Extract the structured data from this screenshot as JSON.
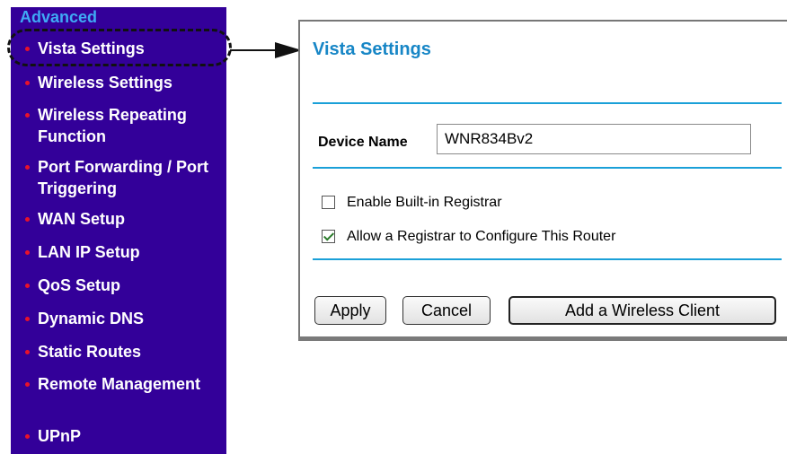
{
  "sidebar": {
    "heading": "Advanced",
    "items": [
      {
        "label": "Vista Settings"
      },
      {
        "label": "Wireless Settings"
      },
      {
        "label": "Wireless Repeating Function"
      },
      {
        "label": "Port Forwarding / Port Triggering"
      },
      {
        "label": "WAN Setup"
      },
      {
        "label": "LAN IP Setup"
      },
      {
        "label": "QoS Setup"
      },
      {
        "label": "Dynamic DNS"
      },
      {
        "label": "Static Routes"
      },
      {
        "label": "Remote Management"
      },
      {
        "label": "UPnP"
      }
    ]
  },
  "panel": {
    "title": "Vista Settings",
    "device_name_label": "Device Name",
    "device_name_value": "WNR834Bv2",
    "options": [
      {
        "label": "Enable Built-in Registrar",
        "checked": false
      },
      {
        "label": "Allow a Registrar to Configure This Router",
        "checked": true
      }
    ],
    "buttons": {
      "apply": "Apply",
      "cancel": "Cancel",
      "add_client": "Add a Wireless Client"
    }
  },
  "colors": {
    "sidebar_bg": "#330099",
    "heading": "#3fa9f5",
    "bullet": "#e8122a",
    "title": "#1786c6",
    "rule": "#1aa0d8"
  },
  "icons": {
    "bullet": "red-dot-icon",
    "arrow": "right-arrow-icon",
    "checkbox": "checkbox-icon"
  }
}
